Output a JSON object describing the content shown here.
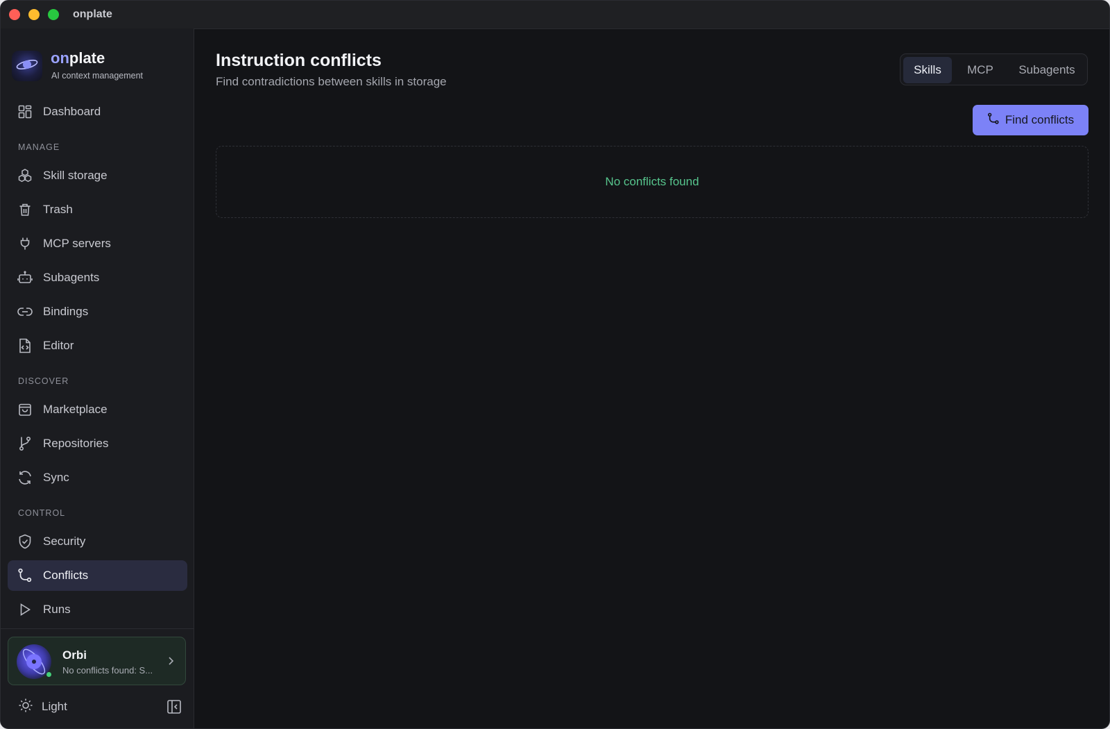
{
  "window": {
    "title": "onplate"
  },
  "brand": {
    "name_accent": "on",
    "name_rest": "plate",
    "subtitle": "AI context management"
  },
  "sidebar": {
    "dashboard": "Dashboard",
    "sections": {
      "manage": "MANAGE",
      "discover": "DISCOVER",
      "control": "CONTROL"
    },
    "manage_items": [
      "Skill storage",
      "Trash",
      "MCP servers",
      "Subagents",
      "Bindings",
      "Editor"
    ],
    "discover_items": [
      "Marketplace",
      "Repositories",
      "Sync"
    ],
    "control_items": [
      "Security",
      "Conflicts",
      "Runs"
    ],
    "active_item": "Conflicts"
  },
  "assistant": {
    "name": "Orbi",
    "status": "No conflicts found: S..."
  },
  "theme": {
    "label": "Light"
  },
  "main": {
    "title": "Instruction conflicts",
    "subtitle": "Find contradictions between skills in storage",
    "tabs": [
      "Skills",
      "MCP",
      "Subagents"
    ],
    "active_tab": "Skills",
    "find_button": "Find conflicts",
    "empty_message": "No conflicts found"
  },
  "colors": {
    "accent": "#7c82f7",
    "success_text": "#57c58d",
    "background": "#131417",
    "sidebar": "#1b1c20"
  },
  "icons": {
    "dashboard": "grid-icon",
    "skill_storage": "boxes-icon",
    "trash": "trash-icon",
    "mcp_servers": "plug-icon",
    "subagents": "bot-icon",
    "bindings": "link-icon",
    "editor": "file-code-icon",
    "marketplace": "shopping-bag-icon",
    "repositories": "git-branch-icon",
    "sync": "refresh-icon",
    "security": "shield-icon",
    "conflicts": "git-compare-icon",
    "runs": "play-icon"
  }
}
